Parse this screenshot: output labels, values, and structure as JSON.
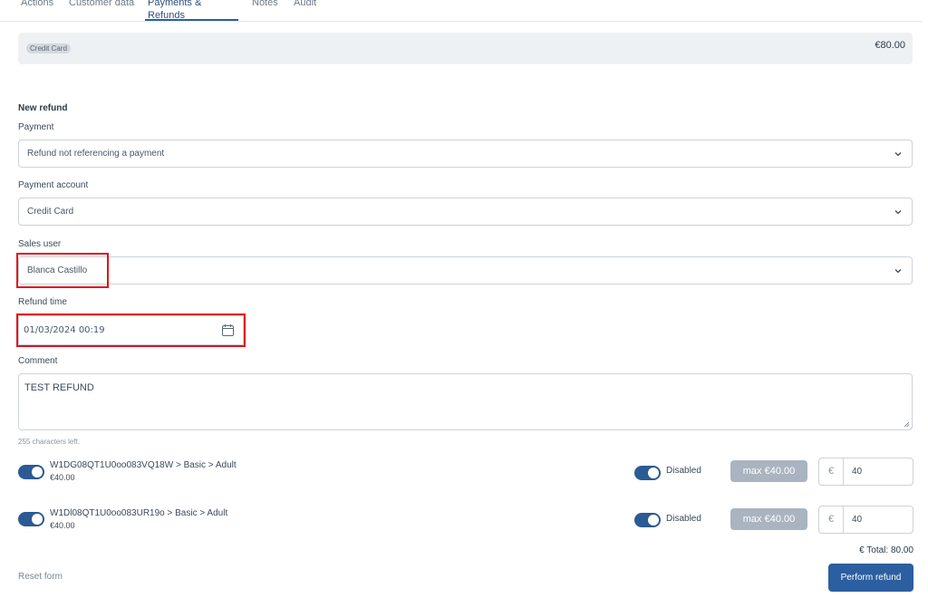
{
  "tabs": [
    {
      "label": "Actions"
    },
    {
      "label": "Customer data"
    },
    {
      "label": "Payments & Refunds"
    },
    {
      "label": "Notes"
    },
    {
      "label": "Audit"
    }
  ],
  "payment_card": {
    "method_badge": "Credit Card",
    "amount": "€80.00"
  },
  "new_refund": {
    "title": "New refund",
    "payment": {
      "label": "Payment",
      "value": "Refund not referencing a payment"
    },
    "payment_account": {
      "label": "Payment account",
      "value": "Credit Card"
    },
    "sales_user": {
      "label": "Sales user",
      "value": "Blanca Castillo"
    },
    "refund_time": {
      "label": "Refund time",
      "value": "01/03/2024 00:19"
    },
    "comment": {
      "label": "Comment",
      "value": "TEST REFUND",
      "chars_left": "255 characters left."
    }
  },
  "items": [
    {
      "title": "W1DG08QT1U0oo083VQ18W > Basic > Adult",
      "price": "€40.00",
      "disabled_label": "Disabled",
      "max_label": "max €40.00",
      "currency": "€",
      "amount": "40"
    },
    {
      "title": "W1Dl08QT1U0oo083UR19o > Basic > Adult",
      "price": "€40.00",
      "disabled_label": "Disabled",
      "max_label": "max €40.00",
      "currency": "€",
      "amount": "40"
    }
  ],
  "total": "€ Total: 80.00",
  "reset_label": "Reset form",
  "perform_label": "Perform refund",
  "colors": {
    "accent": "#2c5fa0",
    "highlight": "#e0121c",
    "toggle": "#2c5a94"
  }
}
